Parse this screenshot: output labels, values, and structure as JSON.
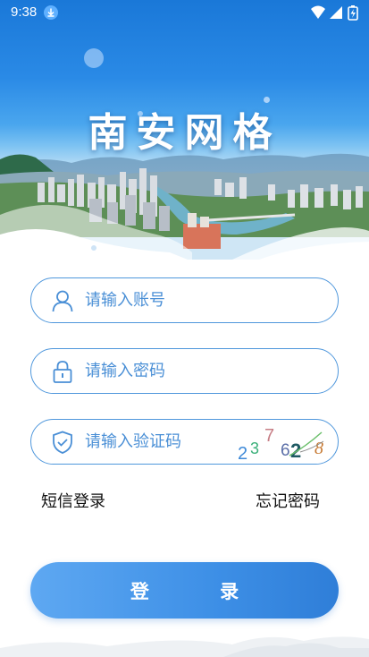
{
  "status_bar": {
    "time": "9:38",
    "icons": [
      "download-icon",
      "wifi-icon",
      "signal-icon",
      "battery-icon"
    ]
  },
  "header": {
    "title": "南安网格"
  },
  "form": {
    "username": {
      "placeholder": "请输入账号",
      "icon": "user-icon"
    },
    "password": {
      "placeholder": "请输入密码",
      "icon": "lock-icon"
    },
    "captcha": {
      "placeholder": "请输入验证码",
      "icon": "shield-check-icon",
      "code": [
        "2",
        "3",
        "7",
        "6",
        "2",
        "8"
      ]
    }
  },
  "links": {
    "sms_login": "短信登录",
    "forgot_password": "忘记密码"
  },
  "login_button": {
    "label": "登 录"
  },
  "colors": {
    "accent": "#4a8fd6",
    "button": "#3d8fe6",
    "hero_top": "#1a78d8"
  }
}
